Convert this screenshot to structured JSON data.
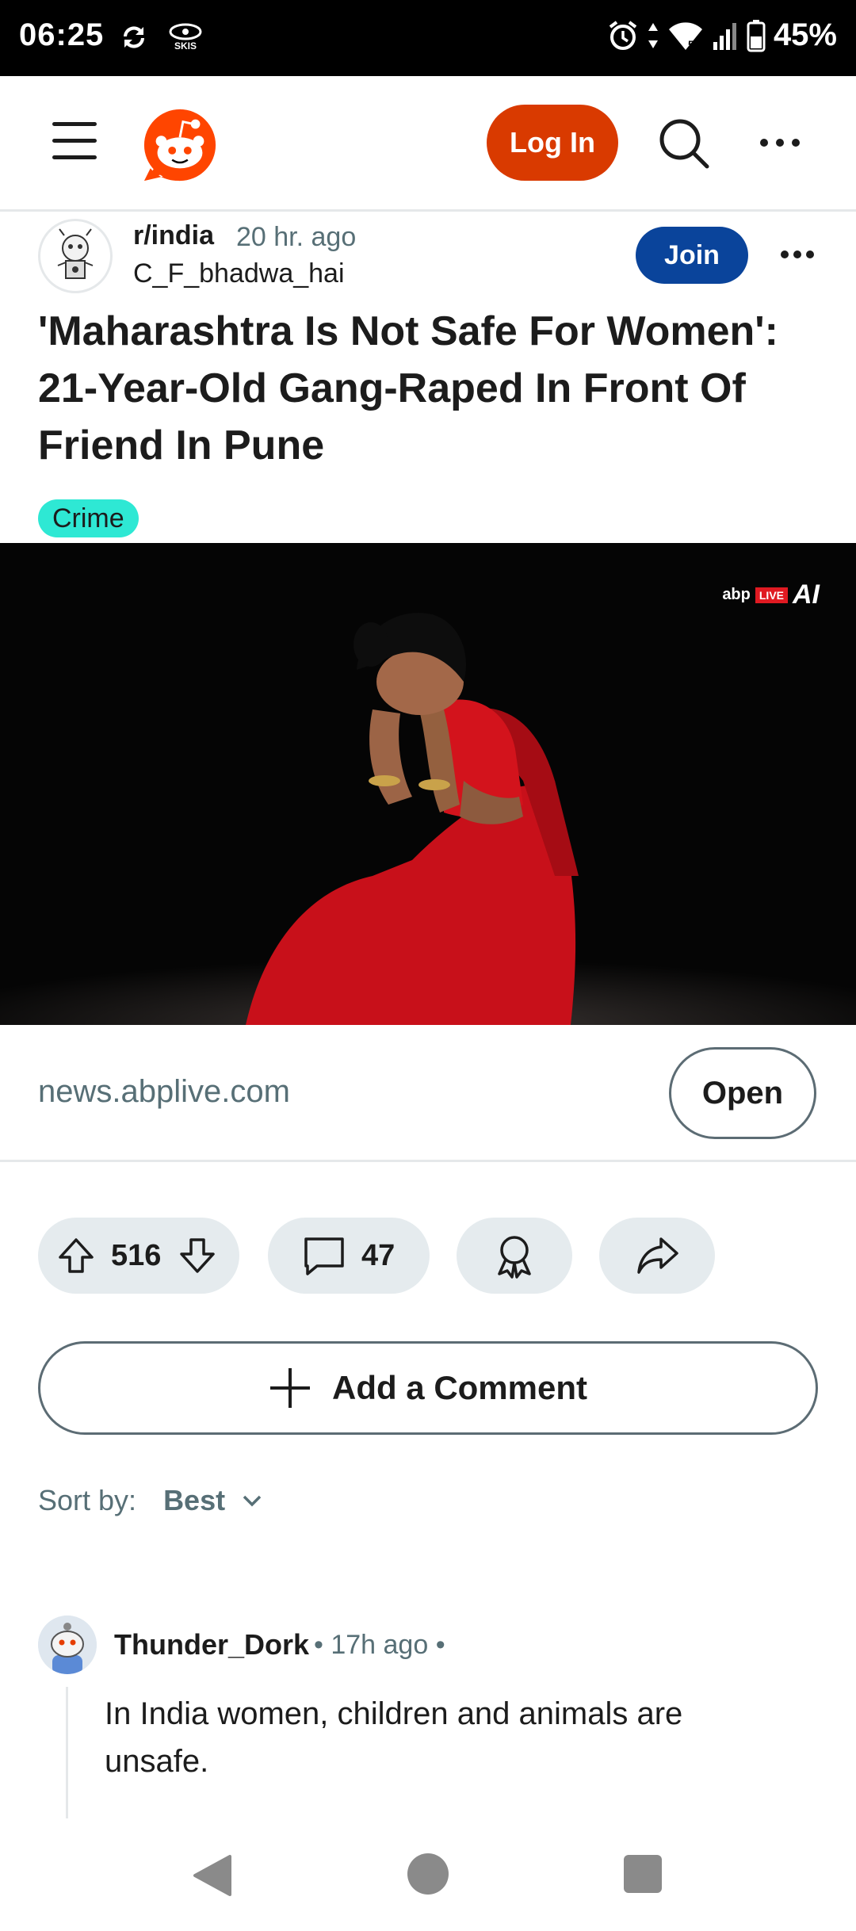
{
  "status_bar": {
    "time": "06:25",
    "left_icons": [
      "sync-icon",
      "skis-app-icon"
    ],
    "skis_label": "SKIS",
    "right_icons": [
      "alarm-icon",
      "data-arrows-icon",
      "wifi-icon",
      "signal-icon",
      "battery-icon"
    ],
    "battery_percent": "45%"
  },
  "header": {
    "login_label": "Log In",
    "brand_color": "#d93a00"
  },
  "post": {
    "subreddit": "r/india",
    "time_ago": "20 hr. ago",
    "author": "C_F_bhadwa_hai",
    "join_label": "Join",
    "title": "'Maharashtra Is Not Safe For Women': 21-Year-Old Gang-Raped In Front Of Friend In Pune",
    "flair": "Crime",
    "image_watermark": {
      "brand": "abp",
      "live": "LIVE",
      "ai": "AI"
    },
    "link_domain": "news.abplive.com",
    "open_label": "Open",
    "votes": "516",
    "comments_count": "47"
  },
  "add_comment_label": "Add a Comment",
  "sort": {
    "label": "Sort by:",
    "value": "Best"
  },
  "comment": {
    "user": "Thunder_Dork",
    "meta": "• 17h ago •",
    "body": "In India women, children and animals are unsafe."
  },
  "colors": {
    "join": "#0a449b",
    "flair": "#2ee8d4",
    "saree": "#d3131c",
    "pill_bg": "#e5ebee"
  }
}
